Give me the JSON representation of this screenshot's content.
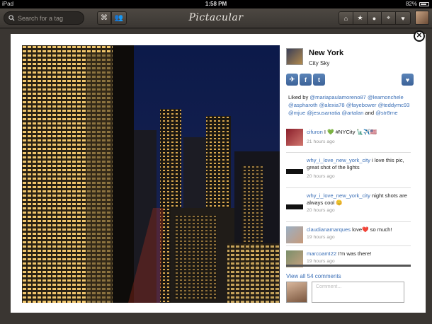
{
  "status_bar": {
    "device": "iPad",
    "time": "1:58 PM",
    "battery": "82%",
    "battery_level": 0.82
  },
  "navbar": {
    "search_placeholder": "Search for a tag",
    "app_title": "Pictacular",
    "icons": [
      "tag-icon",
      "people-icon",
      "home-icon",
      "star-icon",
      "user-icon",
      "location-icon",
      "heart-icon",
      "profile-avatar"
    ]
  },
  "post": {
    "location": "New York",
    "caption": "City Sky",
    "share_icons": [
      "plane-icon",
      "facebook-icon",
      "twitter-icon"
    ],
    "like_icon": "heart-icon",
    "liked_by_prefix": "Liked by",
    "liked_by": [
      "@mariapaulamoreno87",
      "@leamonchele",
      "@aspharoth",
      "@alexia78",
      "@fayebower",
      "@teddymc93",
      "@mjue",
      "@jesusarratia",
      "@artalan"
    ],
    "liked_by_last": "@str8rne",
    "liked_by_and": "and"
  },
  "comments": [
    {
      "user": "cifuron",
      "text": "I 💚 #NYCity 🗽✈️🇺🇸",
      "time": "21 hours ago"
    },
    {
      "user": "why_i_love_new_york_city",
      "text": " i love this pic, great shot of the lights",
      "time": "20 hours ago"
    },
    {
      "user": "why_i_love_new_york_city",
      "text": " night shots are always cool 😊",
      "time": "20 hours ago"
    },
    {
      "user": "claudianamarques",
      "text": " love❤️ so much!",
      "time": "19 hours ago"
    },
    {
      "user": "marcoamI22",
      "text": " I'm was there!",
      "time": "19 hours ago"
    }
  ],
  "view_all": "View all 54 comments",
  "comment_placeholder": "Comment..."
}
